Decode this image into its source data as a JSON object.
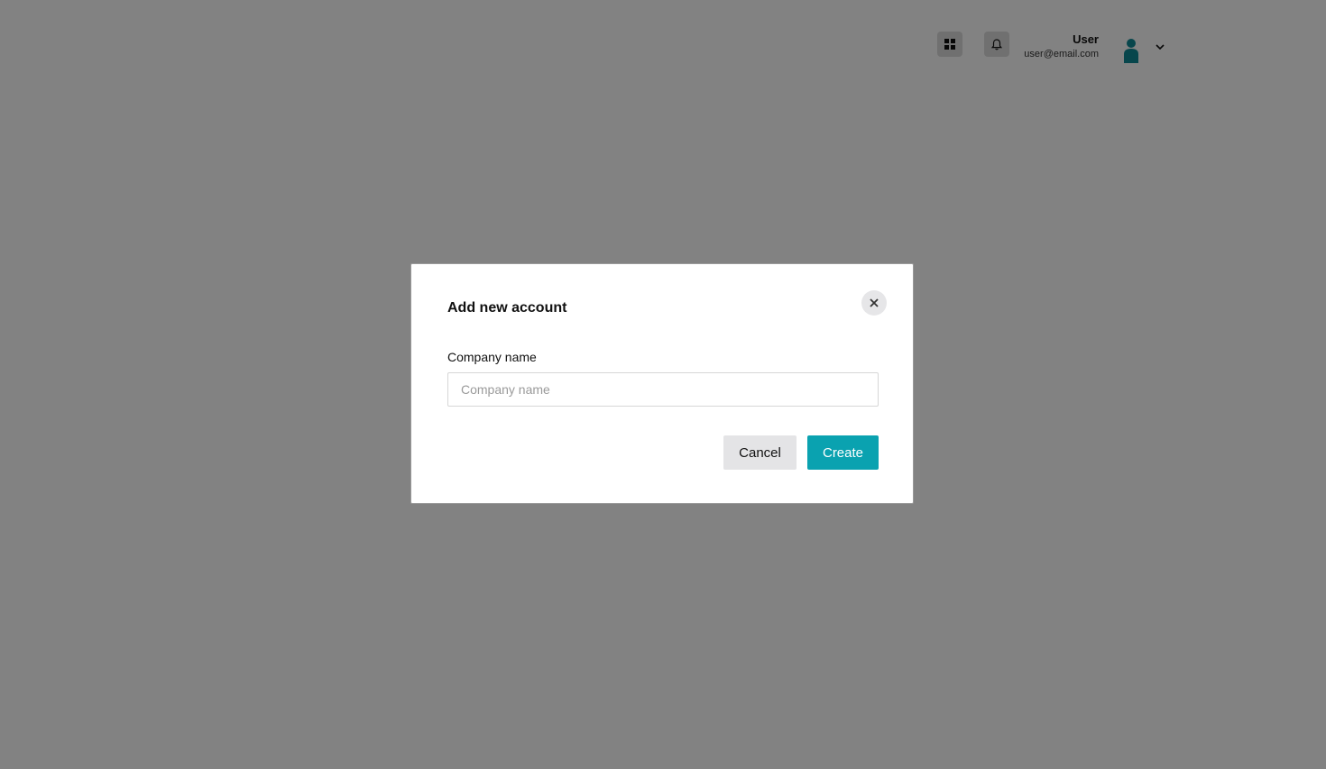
{
  "header": {
    "user_name": "User",
    "user_email": "user@email.com",
    "apps_icon": "grid-icon",
    "notifications_icon": "bell-icon",
    "avatar_icon": "person-icon",
    "menu_icon": "chevron-down-icon"
  },
  "modal": {
    "title": "Add new account",
    "close_icon": "close-icon",
    "field_label": "Company name",
    "field_placeholder": "Company name",
    "field_value": "",
    "cancel_label": "Cancel",
    "create_label": "Create"
  },
  "colors": {
    "accent": "#0aa2b0",
    "avatar": "#0e8a96",
    "overlay": "rgba(0,0,0,0.49)"
  }
}
